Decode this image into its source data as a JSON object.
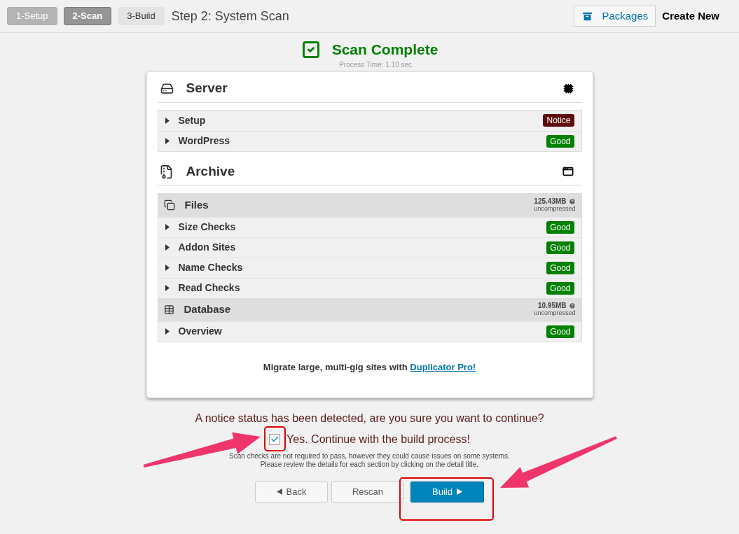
{
  "steps": [
    {
      "label": "1-Setup",
      "selected": false,
      "disabled": true
    },
    {
      "label": "2-Scan",
      "selected": true,
      "disabled": false
    },
    {
      "label": "3-Build",
      "selected": false,
      "disabled": false
    }
  ],
  "page_title": "Step 2: System Scan",
  "header_links": {
    "packages": "Packages",
    "create_new": "Create New"
  },
  "scan": {
    "title": "Scan Complete",
    "process_time": "Process Time: 1.10 sec."
  },
  "server": {
    "title": "Server",
    "rows": [
      {
        "label": "Setup",
        "status": "Notice",
        "kind": "notice"
      },
      {
        "label": "WordPress",
        "status": "Good",
        "kind": "good"
      }
    ]
  },
  "archive": {
    "title": "Archive",
    "groups": [
      {
        "kind": "files",
        "title": "Files",
        "size": "125.43MB",
        "note": "uncompressed",
        "rows": [
          {
            "label": "Size Checks",
            "status": "Good",
            "kind": "good"
          },
          {
            "label": "Addon Sites",
            "status": "Good",
            "kind": "good"
          },
          {
            "label": "Name Checks",
            "status": "Good",
            "kind": "good"
          },
          {
            "label": "Read Checks",
            "status": "Good",
            "kind": "good"
          }
        ]
      },
      {
        "kind": "database",
        "title": "Database",
        "size": "10.95MB",
        "note": "uncompressed",
        "rows": [
          {
            "label": "Overview",
            "status": "Good",
            "kind": "good"
          }
        ]
      }
    ]
  },
  "promo": {
    "text": "Migrate large, multi-gig sites with",
    "link": "Duplicator Pro!"
  },
  "confirm": {
    "question": "A notice status has been detected, are you sure you want to continue?",
    "checkbox_label": "Yes. Continue with the build process!",
    "checked": true,
    "note_lines": [
      "Scan checks are not required to pass, however they could cause issues on some systems.",
      "Please review the details for each section by clicking on the detail title."
    ]
  },
  "buttons": {
    "back": "Back",
    "rescan": "Rescan",
    "build": "Build"
  }
}
